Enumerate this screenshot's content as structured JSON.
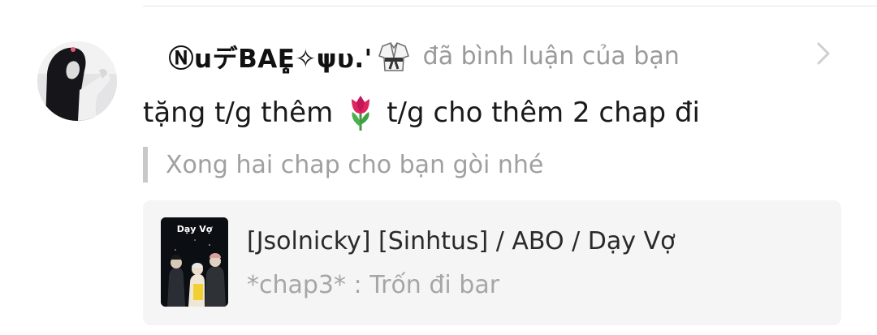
{
  "notification": {
    "username": " ⓃuデBAE̥̥͈✧ψυ.'",
    "action_text": "đã bình luận của bạn",
    "comment_before": "tặng t/g thêm",
    "comment_after": "t/g cho thêm 2 chap đi",
    "quoted_reply": "Xong hai chap cho bạn gòi nhé"
  },
  "story": {
    "cover_title": "Dạy Vợ",
    "title": "[Jsolnicky] [Sinhtus] / ABO / Dạy Vợ",
    "chapter": "*chap3* : Trốn đi bar"
  },
  "icons": {
    "avatar": "user-avatar",
    "username_emoji": "martial-arts-uniform-icon",
    "comment_emoji": "tulip-icon",
    "chevron": "chevron-right-icon"
  }
}
